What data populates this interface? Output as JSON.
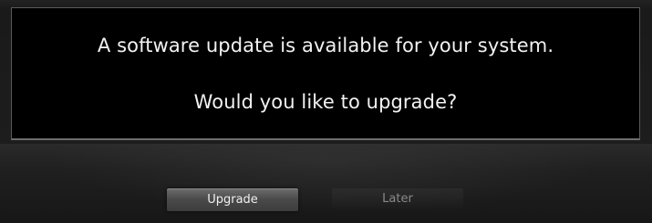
{
  "dialog": {
    "line1": "A software update is available for your system.",
    "line2": "Would you like to upgrade?"
  },
  "buttons": {
    "upgrade_label": "Upgrade",
    "later_label": "Later"
  },
  "colors": {
    "dialog_background": "#000000",
    "text": "#f2f2f2",
    "screen_background": "#1b1b1b",
    "focused_button": "#4a4a4a",
    "inactive_button_text": "#8a8a8a"
  }
}
